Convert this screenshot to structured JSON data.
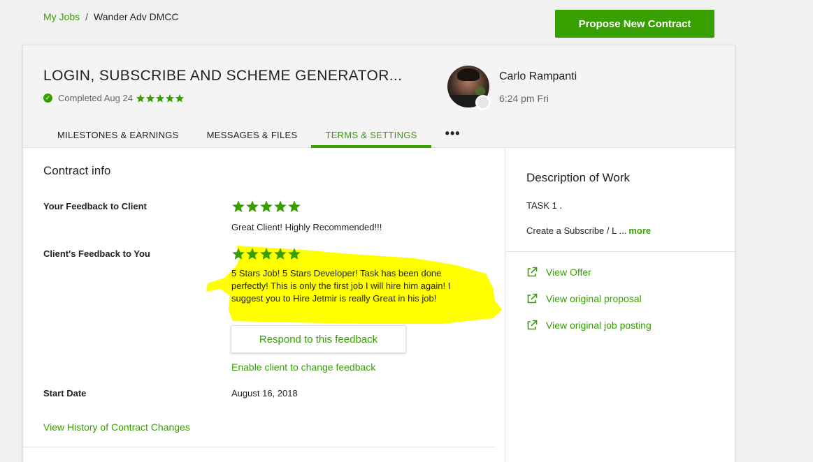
{
  "breadcrumb": {
    "root": "My Jobs",
    "separator": "/",
    "current": "Wander Adv DMCC"
  },
  "actions": {
    "propose_label": "Propose New Contract"
  },
  "job": {
    "title": "LOGIN, SUBSCRIBE AND SCHEME GENERATOR...",
    "status": "Completed Aug 24",
    "rating_stars": 5
  },
  "client": {
    "name": "Carlo Rampanti",
    "local_time": "6:24 pm Fri"
  },
  "tabs": [
    {
      "label": "MILESTONES & EARNINGS"
    },
    {
      "label": "MESSAGES & FILES"
    },
    {
      "label": "TERMS & SETTINGS",
      "active": true
    }
  ],
  "tabs_more": "•••",
  "contract": {
    "section_title": "Contract info",
    "your_feedback_label": "Your Feedback to Client",
    "your_feedback_stars": 5,
    "your_feedback_text": "Great Client! Highly Recommended!!!",
    "client_feedback_label": "Client's Feedback to You",
    "client_feedback_stars": 5,
    "client_feedback_text": "5 Stars Job! 5 Stars Developer! Task has been done perfectly! This is only the first job I will hire him again! I suggest you to Hire Jetmir is really Great in his job!",
    "respond_label": "Respond to this feedback",
    "enable_change_label": "Enable client to change feedback",
    "start_date_label": "Start Date",
    "start_date_value": "August 16, 2018",
    "history_link": "View History of Contract Changes"
  },
  "description": {
    "title": "Description of Work",
    "line1": "TASK 1 .",
    "line2": "Create a Subscribe / L ...",
    "more_label": "more"
  },
  "side_links": [
    {
      "label": "View Offer",
      "icon": "external-link-icon"
    },
    {
      "label": "View original proposal",
      "icon": "external-link-icon"
    },
    {
      "label": "View original job posting",
      "icon": "external-link-icon"
    }
  ],
  "colors": {
    "accent": "#37a000",
    "highlight": "#ffff00"
  }
}
